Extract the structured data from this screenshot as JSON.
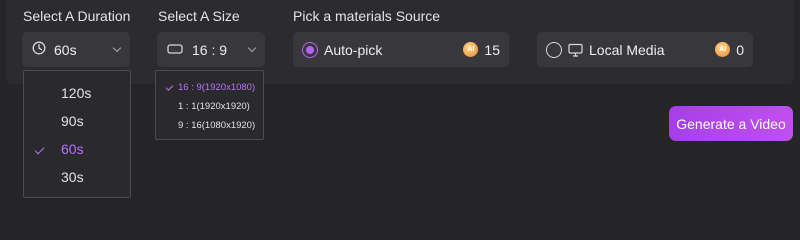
{
  "duration": {
    "label": "Select A Duration",
    "selected": "60s",
    "options": [
      {
        "label": "120s",
        "selected": false
      },
      {
        "label": "90s",
        "selected": false
      },
      {
        "label": "60s",
        "selected": true
      },
      {
        "label": "30s",
        "selected": false
      }
    ]
  },
  "size": {
    "label": "Select A Size",
    "selected": "16 : 9",
    "options": [
      {
        "label": "16 : 9(1920x1080)",
        "selected": true
      },
      {
        "label": "1 : 1(1920x1920)",
        "selected": false
      },
      {
        "label": "9 : 16(1080x1920)",
        "selected": false
      }
    ]
  },
  "source": {
    "label": "Pick a materials Source",
    "options": [
      {
        "label": "Auto-pick",
        "checked": true,
        "badge": "AI",
        "count": "15"
      },
      {
        "label": "Local Media",
        "checked": false,
        "badge": "AI",
        "count": "0"
      }
    ]
  },
  "generate_button": "Generate a Video",
  "colors": {
    "accent": "#b772f7",
    "button_gradient_start": "#a63fe8",
    "button_gradient_end": "#c04ff0",
    "background": "#252527",
    "panel": "#2c2c2f"
  }
}
